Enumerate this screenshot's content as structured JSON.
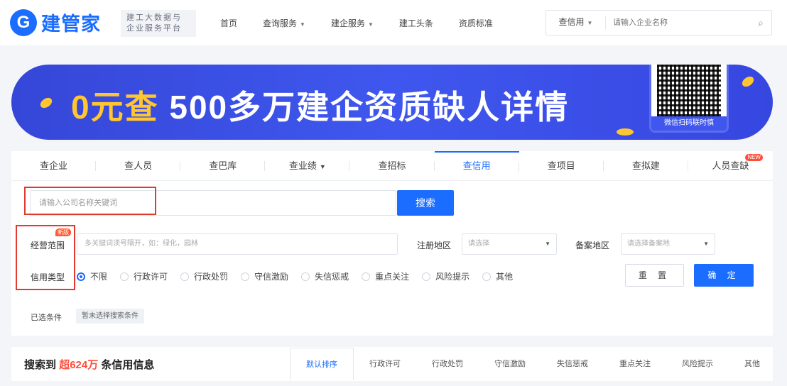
{
  "header": {
    "logo_mark": "G",
    "logo_text": "建管家",
    "slogan_line1": "建工大数据与",
    "slogan_line2": "企业服务平台",
    "nav": [
      {
        "label": "首页",
        "dropdown": false
      },
      {
        "label": "查询服务",
        "dropdown": true
      },
      {
        "label": "建企服务",
        "dropdown": true
      },
      {
        "label": "建工头条",
        "dropdown": false
      },
      {
        "label": "资质标准",
        "dropdown": false
      }
    ],
    "search_type": "查信用",
    "search_placeholder": "请输入企业名称"
  },
  "banner": {
    "highlight": "0元查",
    "text": "500多万建企资质缺人详情",
    "qr_caption": "微信扫码联时慎"
  },
  "tabs": [
    {
      "label": "查企业",
      "active": false
    },
    {
      "label": "查人员",
      "active": false
    },
    {
      "label": "查巴库",
      "active": false
    },
    {
      "label": "查业绩",
      "active": false,
      "dropdown": true
    },
    {
      "label": "查招标",
      "active": false
    },
    {
      "label": "查信用",
      "active": true
    },
    {
      "label": "查项目",
      "active": false
    },
    {
      "label": "查拟建",
      "active": false
    },
    {
      "label": "人员查缺",
      "active": false,
      "badge": "NEW"
    }
  ],
  "search": {
    "keyword_placeholder": "请输入公司名称关键词",
    "search_button": "搜索",
    "scope_label": "经营范围",
    "scope_badge": "新版",
    "scope_placeholder": "多关键词须号隔开，如：绿化，园林",
    "reg_area_label": "注册地区",
    "reg_area_placeholder": "请选择",
    "filing_area_label": "备案地区",
    "filing_area_placeholder": "请选择备案地",
    "credit_type_label": "信用类型",
    "credit_types": [
      "不限",
      "行政许可",
      "行政处罚",
      "守信激励",
      "失信惩戒",
      "重点关注",
      "风险提示",
      "其他"
    ],
    "credit_type_selected": "不限",
    "reset_button": "重 置",
    "confirm_button": "确 定",
    "selected_label": "已选条件",
    "selected_hint": "暂未选择搜索条件"
  },
  "results": {
    "prefix": "搜索到",
    "count": "超624万",
    "suffix": "条信用信息",
    "sorts": [
      "默认排序",
      "行政许可",
      "行政处罚",
      "守信激励",
      "失信惩戒",
      "重点关注",
      "风险提示",
      "其他"
    ],
    "active_sort": "默认排序"
  },
  "colors": {
    "brand": "#1b6dff",
    "highlight_red": "#e23a2e",
    "banner_blue": "#3f57ee",
    "banner_gold": "#ffc630"
  }
}
